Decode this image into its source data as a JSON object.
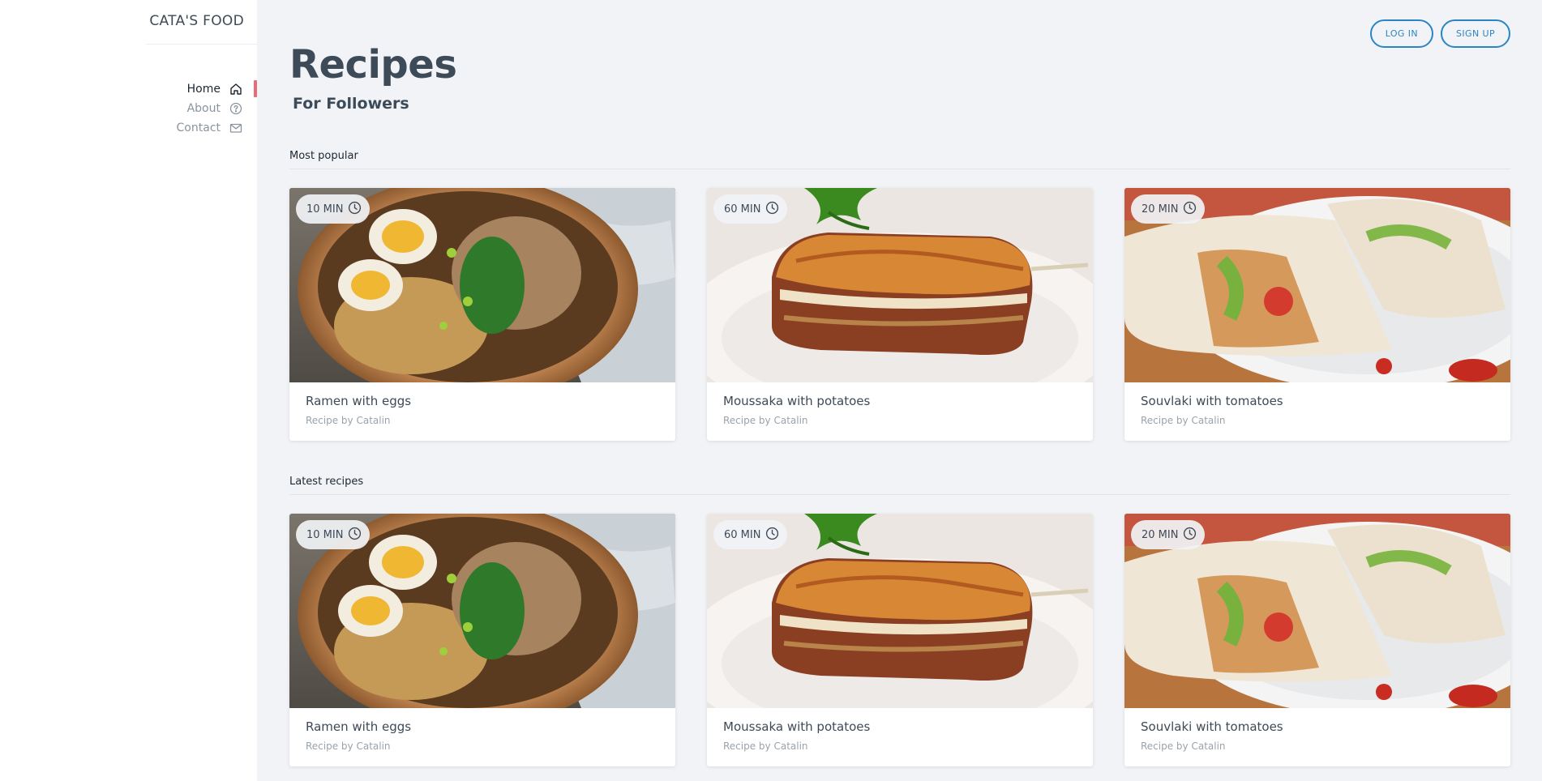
{
  "brand": "CATA'S FOOD",
  "nav": [
    {
      "label": "Home",
      "icon": "home-icon",
      "active": true
    },
    {
      "label": "About",
      "icon": "help-circle-icon",
      "active": false
    },
    {
      "label": "Contact",
      "icon": "mail-icon",
      "active": false
    }
  ],
  "auth": {
    "login_label": "LOG IN",
    "signup_label": "SIGN UP"
  },
  "page": {
    "title": "Recipes",
    "subtitle": "For Followers"
  },
  "colors": {
    "accent": "#2b85c5",
    "active_marker": "#e96b77",
    "background": "#f1f3f6"
  },
  "sections": [
    {
      "heading": "Most popular",
      "cards": [
        {
          "time": "10 MIN",
          "title": "Ramen with eggs",
          "author": "Recipe by Catalin",
          "image": "ramen-image"
        },
        {
          "time": "60 MIN",
          "title": "Moussaka with potatoes",
          "author": "Recipe by Catalin",
          "image": "moussaka-image"
        },
        {
          "time": "20 MIN",
          "title": "Souvlaki with tomatoes",
          "author": "Recipe by Catalin",
          "image": "souvlaki-image"
        }
      ]
    },
    {
      "heading": "Latest recipes",
      "cards": [
        {
          "time": "10 MIN",
          "title": "Ramen with eggs",
          "author": "Recipe by Catalin",
          "image": "ramen-image"
        },
        {
          "time": "60 MIN",
          "title": "Moussaka with potatoes",
          "author": "Recipe by Catalin",
          "image": "moussaka-image"
        },
        {
          "time": "20 MIN",
          "title": "Souvlaki with tomatoes",
          "author": "Recipe by Catalin",
          "image": "souvlaki-image"
        }
      ]
    }
  ]
}
